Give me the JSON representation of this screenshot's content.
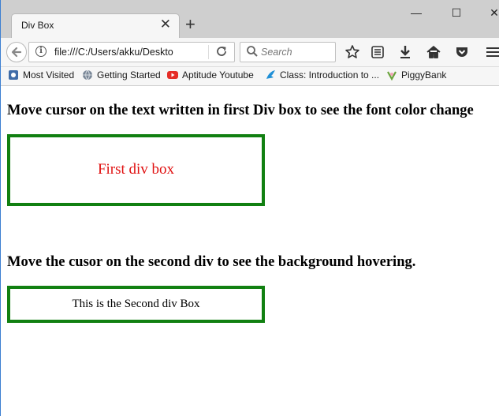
{
  "browser": {
    "tab": {
      "title": "Div Box",
      "close_glyph": "✕"
    },
    "new_tab_glyph": "+",
    "window_controls": {
      "minimize": "—",
      "maximize": "☐",
      "close": "✕"
    },
    "address": {
      "value": "file:///C:/Users/akku/Deskto",
      "icon": "info-icon"
    },
    "search": {
      "placeholder": "Search"
    },
    "toolbar_icons": [
      "star-icon",
      "reading-list-icon",
      "download-icon",
      "home-icon",
      "pocket-icon",
      "menu-icon"
    ],
    "bookmarks": [
      {
        "label": "Most Visited",
        "icon": "most-visited-icon"
      },
      {
        "label": "Getting Started",
        "icon": "globe-icon"
      },
      {
        "label": "Aptitude Youtube",
        "icon": "youtube-icon"
      },
      {
        "label": "Class: Introduction to ...",
        "icon": "bird-icon"
      },
      {
        "label": "PiggyBank",
        "icon": "piggybank-icon"
      }
    ]
  },
  "page": {
    "heading1": "Move cursor on the text written in first Div box to see the font color change",
    "box1_text": "First div box",
    "heading2": "Move the cusor on the second div to see the background hovering.",
    "box2_text": "This is the Second div Box"
  },
  "colors": {
    "box_border": "#118011",
    "box1_text": "#e01010"
  }
}
